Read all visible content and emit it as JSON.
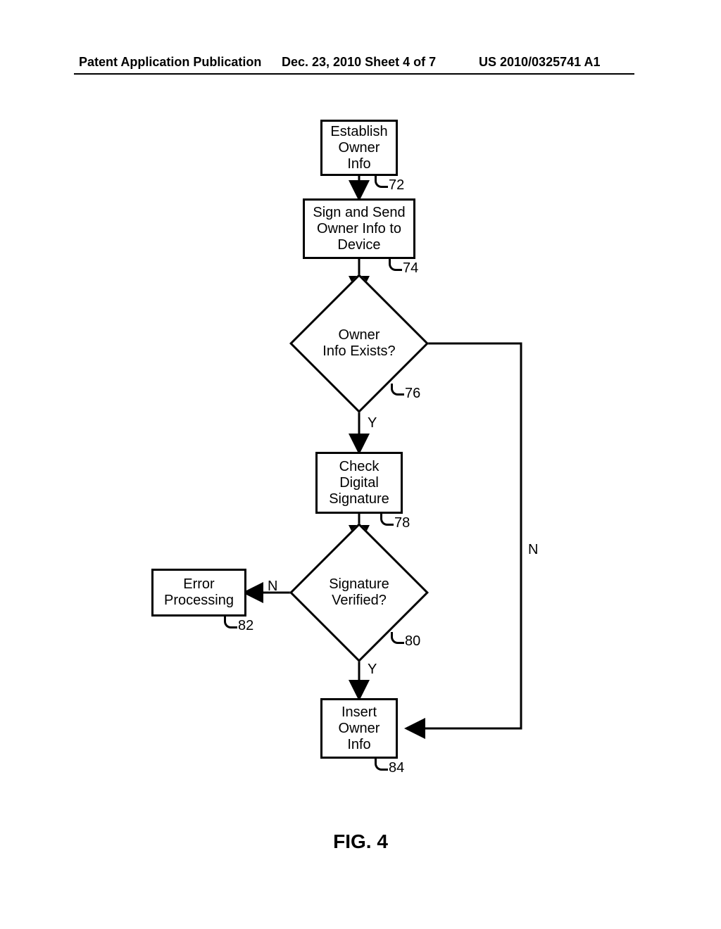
{
  "header": {
    "left": "Patent Application Publication",
    "mid": "Dec. 23, 2010  Sheet 4 of 7",
    "right": "US 2010/0325741 A1"
  },
  "figure_caption": "FIG. 4",
  "nodes": {
    "n72": {
      "text": "Establish\nOwner\nInfo",
      "ref": "72"
    },
    "n74": {
      "text": "Sign and Send\nOwner Info to\nDevice",
      "ref": "74"
    },
    "n76": {
      "text": "Owner\nInfo Exists?",
      "ref": "76"
    },
    "n78": {
      "text": "Check\nDigital\nSignature",
      "ref": "78"
    },
    "n80": {
      "text": "Signature\nVerified?",
      "ref": "80"
    },
    "n82": {
      "text": "Error\nProcessing",
      "ref": "82"
    },
    "n84": {
      "text": "Insert\nOwner\nInfo",
      "ref": "84"
    }
  },
  "edge_labels": {
    "y1": "Y",
    "y2": "Y",
    "n_to_82": "N",
    "n_right": "N"
  },
  "chart_data": {
    "type": "flowchart",
    "nodes": [
      {
        "id": 72,
        "shape": "process",
        "label": "Establish Owner Info"
      },
      {
        "id": 74,
        "shape": "process",
        "label": "Sign and Send Owner Info to Device"
      },
      {
        "id": 76,
        "shape": "decision",
        "label": "Owner Info Exists?"
      },
      {
        "id": 78,
        "shape": "process",
        "label": "Check Digital Signature"
      },
      {
        "id": 80,
        "shape": "decision",
        "label": "Signature Verified?"
      },
      {
        "id": 82,
        "shape": "process",
        "label": "Error Processing"
      },
      {
        "id": 84,
        "shape": "process",
        "label": "Insert Owner Info"
      }
    ],
    "edges": [
      {
        "from": 72,
        "to": 74,
        "label": ""
      },
      {
        "from": 74,
        "to": 76,
        "label": ""
      },
      {
        "from": 76,
        "to": 78,
        "label": "Y"
      },
      {
        "from": 76,
        "to": 84,
        "label": "N"
      },
      {
        "from": 78,
        "to": 80,
        "label": ""
      },
      {
        "from": 80,
        "to": 82,
        "label": "N"
      },
      {
        "from": 80,
        "to": 84,
        "label": "Y"
      }
    ]
  }
}
